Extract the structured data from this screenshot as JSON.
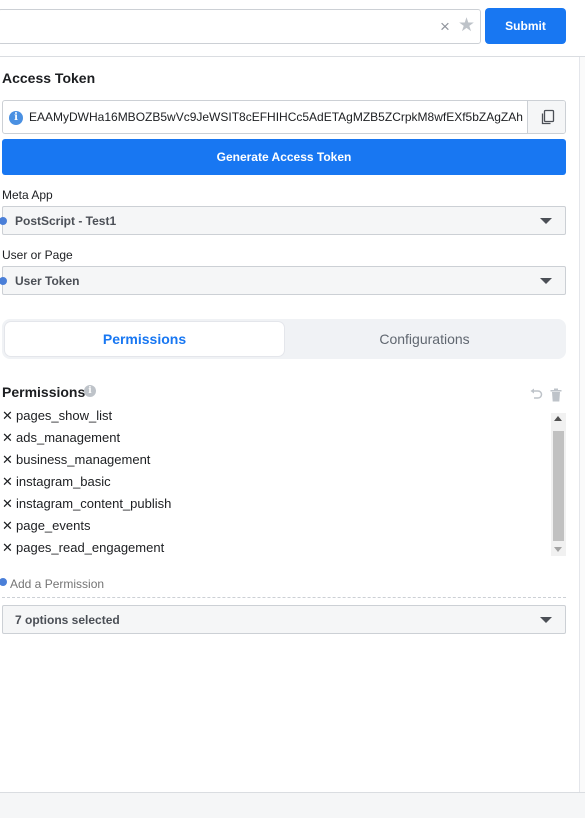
{
  "topbar": {
    "search_value": "",
    "clear_glyph": "×",
    "star_glyph": "★",
    "submit_label": "Submit"
  },
  "access_token": {
    "title": "Access Token",
    "value": "EAAMyDWHa16MBOZB5wVc9JeWSIT8cEFHIHCc5AdETAgMZB5ZCrpkM8wfEXf5bZAgZAh",
    "info_icon": "info-icon",
    "copy_icon": "copy-icon",
    "generate_label": "Generate Access Token"
  },
  "meta_app": {
    "label": "Meta App",
    "selected": "PostScript - Test1"
  },
  "user_or_page": {
    "label": "User or Page",
    "selected": "User Token"
  },
  "tabs": [
    {
      "label": "Permissions",
      "active": true
    },
    {
      "label": "Configurations",
      "active": false
    }
  ],
  "permissions": {
    "title": "Permissions",
    "items": [
      "pages_show_list",
      "ads_management",
      "business_management",
      "instagram_basic",
      "instagram_content_publish",
      "page_events",
      "pages_read_engagement"
    ],
    "add_placeholder": "Add a Permission",
    "selected_summary": "7 options selected"
  },
  "colors": {
    "accent": "#1877f2",
    "field_bg": "#f5f6f7",
    "handle_dot": "#4a7fd8"
  }
}
